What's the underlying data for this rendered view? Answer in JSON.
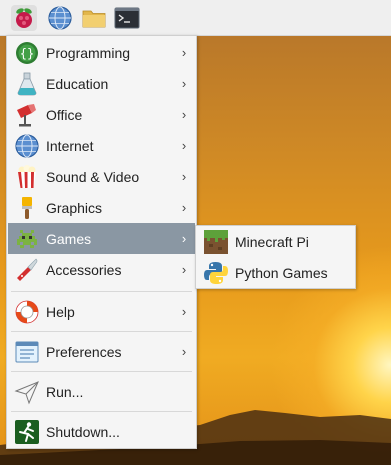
{
  "panel": {
    "buttons": [
      {
        "icon": "raspberry-pi-menu-icon"
      },
      {
        "icon": "web-browser-icon"
      },
      {
        "icon": "file-manager-icon"
      },
      {
        "icon": "terminal-icon"
      }
    ]
  },
  "menu": {
    "items": [
      {
        "label": "Programming",
        "icon": "programming-icon",
        "submenu": true
      },
      {
        "label": "Education",
        "icon": "education-flask-icon",
        "submenu": true
      },
      {
        "label": "Office",
        "icon": "office-icon",
        "submenu": true
      },
      {
        "label": "Internet",
        "icon": "globe-icon",
        "submenu": true
      },
      {
        "label": "Sound & Video",
        "icon": "popcorn-icon",
        "submenu": true
      },
      {
        "label": "Graphics",
        "icon": "paintbrush-icon",
        "submenu": true
      },
      {
        "label": "Games",
        "icon": "game-alien-icon",
        "submenu": true,
        "selected": true
      },
      {
        "label": "Accessories",
        "icon": "knife-icon",
        "submenu": true
      },
      {
        "label": "Help",
        "icon": "lifebuoy-icon",
        "submenu": true
      },
      {
        "label": "Preferences",
        "icon": "preferences-icon",
        "submenu": true
      },
      {
        "label": "Run...",
        "icon": "paper-plane-icon",
        "submenu": false
      },
      {
        "label": "Shutdown...",
        "icon": "shutdown-icon",
        "submenu": false
      }
    ],
    "arrow": "›"
  },
  "games_submenu": {
    "items": [
      {
        "label": "Minecraft Pi",
        "icon": "minecraft-icon"
      },
      {
        "label": "Python Games",
        "icon": "python-icon"
      }
    ]
  },
  "colors": {
    "selected_bg": "#8a97a3",
    "menu_bg": "#f5f5f5"
  }
}
